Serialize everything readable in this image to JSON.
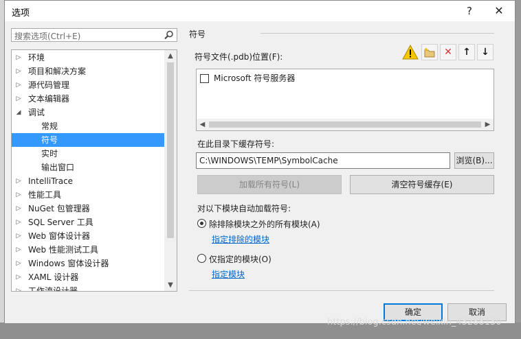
{
  "window": {
    "title": "选项",
    "help": "?",
    "close": "✕"
  },
  "search": {
    "placeholder": "搜索选项(Ctrl+E)"
  },
  "tree": {
    "items": [
      {
        "label": "环境",
        "level": 0,
        "expander": "collapsed"
      },
      {
        "label": "项目和解决方案",
        "level": 0,
        "expander": "collapsed"
      },
      {
        "label": "源代码管理",
        "level": 0,
        "expander": "collapsed"
      },
      {
        "label": "文本编辑器",
        "level": 0,
        "expander": "collapsed"
      },
      {
        "label": "调试",
        "level": 0,
        "expander": "expanded"
      },
      {
        "label": "常规",
        "level": 1,
        "expander": "none"
      },
      {
        "label": "符号",
        "level": 1,
        "expander": "none",
        "selected": true
      },
      {
        "label": "实时",
        "level": 1,
        "expander": "none"
      },
      {
        "label": "输出窗口",
        "level": 1,
        "expander": "none"
      },
      {
        "label": "IntelliTrace",
        "level": 0,
        "expander": "collapsed"
      },
      {
        "label": "性能工具",
        "level": 0,
        "expander": "collapsed"
      },
      {
        "label": "NuGet 包管理器",
        "level": 0,
        "expander": "collapsed"
      },
      {
        "label": "SQL Server 工具",
        "level": 0,
        "expander": "collapsed"
      },
      {
        "label": "Web 窗体设计器",
        "level": 0,
        "expander": "collapsed"
      },
      {
        "label": "Web 性能测试工具",
        "level": 0,
        "expander": "collapsed"
      },
      {
        "label": "Windows 窗体设计器",
        "level": 0,
        "expander": "collapsed"
      },
      {
        "label": "XAML 设计器",
        "level": 0,
        "expander": "collapsed"
      },
      {
        "label": "工作流设计器",
        "level": 0,
        "expander": "collapsed"
      }
    ]
  },
  "symbols": {
    "section_title": "符号",
    "pdb_label": "符号文件(.pdb)位置(F):",
    "toolbar": {
      "new_folder": "new-folder-icon",
      "delete": "✕",
      "move_up": "↑",
      "move_down": "↓"
    },
    "locations": [
      {
        "label": "Microsoft 符号服务器",
        "checked": false
      }
    ],
    "cache_label": "在此目录下缓存符号:",
    "cache_path": "C:\\WINDOWS\\TEMP\\SymbolCache",
    "browse": "浏览(B)...",
    "load_all": "加载所有符号(L)",
    "clear_cache": "清空符号缓存(E)",
    "auto_load_label": "对以下模块自动加载符号:",
    "option_all": "除排除模块之外的所有模块(A)",
    "link_exclude": "指定排除的模块",
    "option_specified": "仅指定的模块(O)",
    "link_specify": "指定模块",
    "selected_option": "all"
  },
  "footer": {
    "ok": "确定",
    "cancel": "取消"
  },
  "watermark": "https://blog.csdn.net/weixin_43288130",
  "colors": {
    "selection": "#3399ff",
    "link": "#0066cc",
    "warning": "#f7c600",
    "delete": "#d13438",
    "default_button_border": "#0078d7"
  }
}
